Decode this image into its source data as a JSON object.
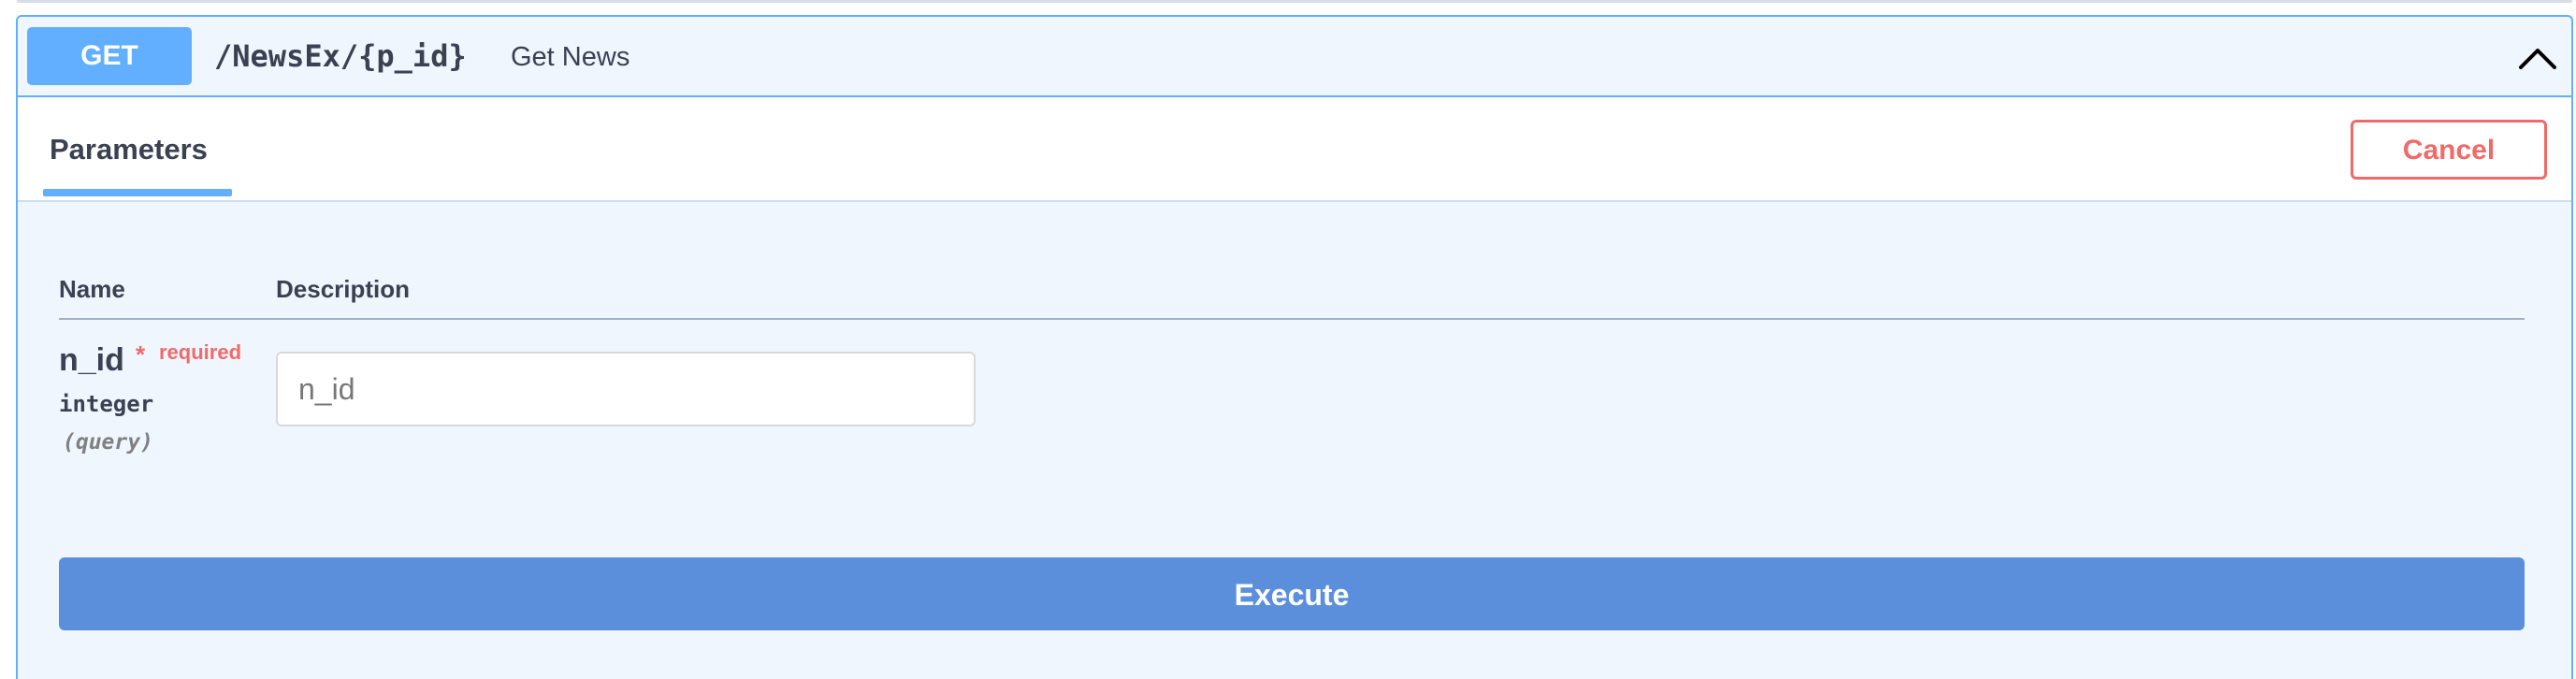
{
  "operation": {
    "method": "GET",
    "path": "/NewsEx/{p_id}",
    "summary": "Get News",
    "method_color": "#61affe",
    "toggle_icon": "chevron-up-icon"
  },
  "tabs": {
    "parameters_label": "Parameters",
    "cancel_label": "Cancel",
    "cancel_color": "#f06a6a"
  },
  "params_table": {
    "headers": [
      "Name",
      "Description"
    ],
    "rows": [
      {
        "name": "n_id",
        "required_mark": "*",
        "required_label": "required",
        "type": "integer",
        "location": "(query)",
        "input_value": "",
        "input_placeholder": "n_id"
      }
    ]
  },
  "execute": {
    "label": "Execute",
    "color": "#5b8fdc"
  }
}
